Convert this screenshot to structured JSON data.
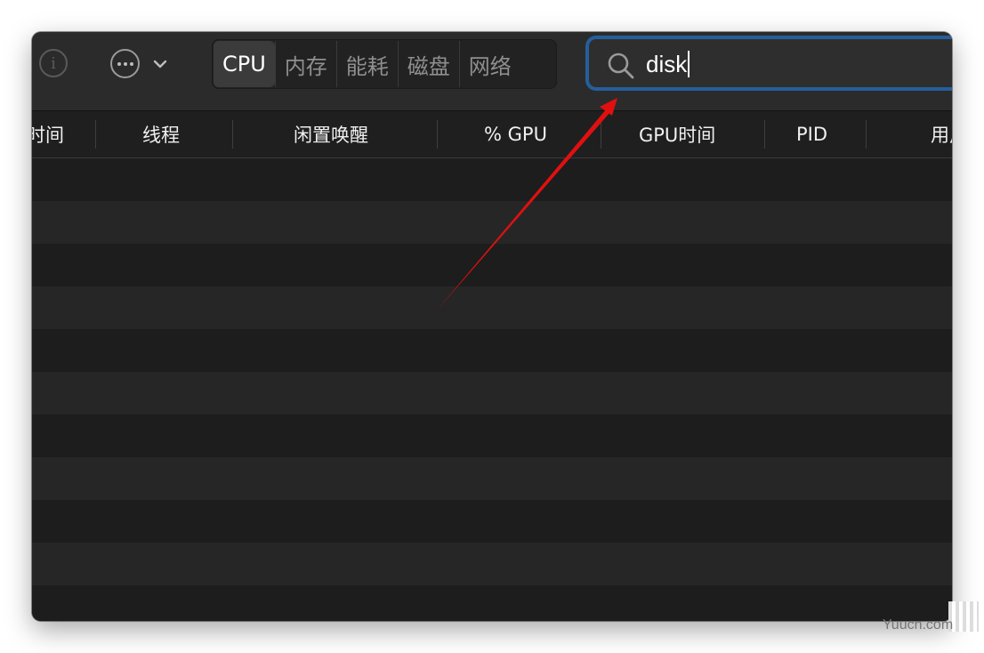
{
  "toolbar": {
    "info_icon": "info-icon",
    "more_icon": "ellipsis-circle-icon",
    "tabs": [
      {
        "label": "CPU",
        "active": true
      },
      {
        "label": "内存",
        "active": false
      },
      {
        "label": "能耗",
        "active": false
      },
      {
        "label": "磁盘",
        "active": false
      },
      {
        "label": "网络",
        "active": false
      }
    ]
  },
  "search": {
    "value": "disk",
    "icon": "search-icon",
    "focus_color": "#245f9c"
  },
  "table": {
    "columns": [
      {
        "label": "时间"
      },
      {
        "label": "线程"
      },
      {
        "label": "闲置唤醒"
      },
      {
        "label": "% GPU"
      },
      {
        "label": "GPU时间"
      },
      {
        "label": "PID"
      },
      {
        "label": "用户"
      }
    ]
  },
  "annotation": {
    "arrow_color": "#e01010"
  },
  "watermark": {
    "text": "Yuucn.com"
  }
}
